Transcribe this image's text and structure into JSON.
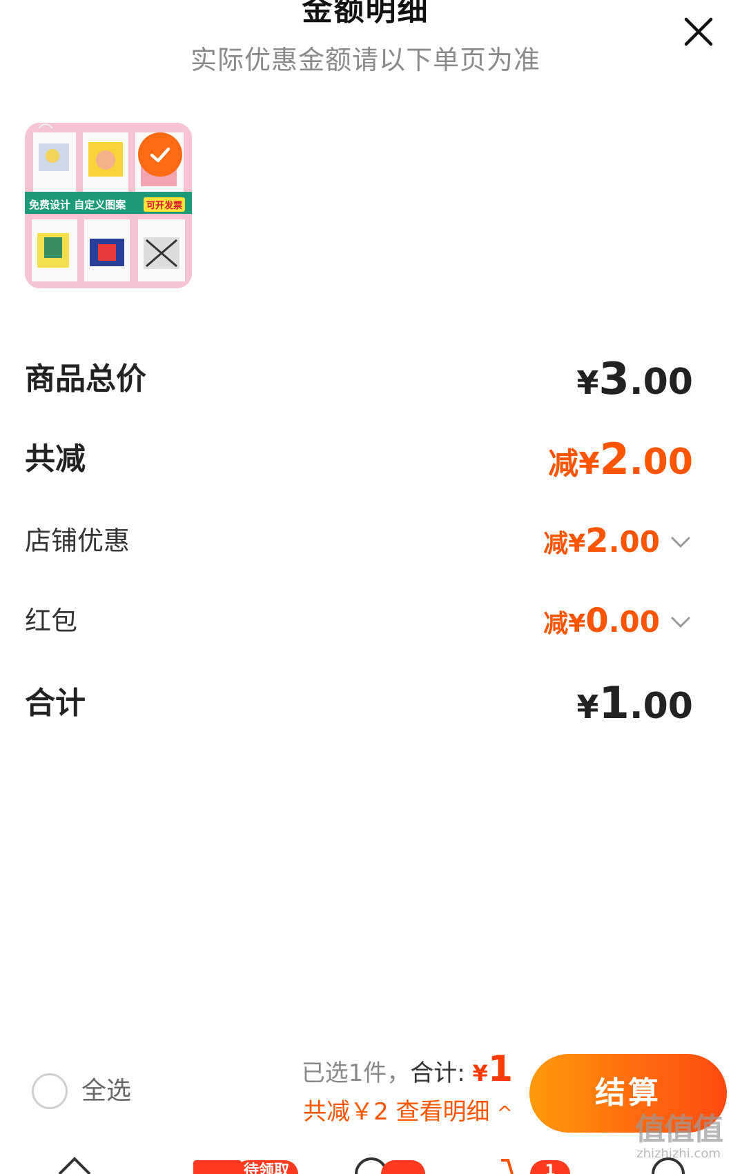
{
  "header": {
    "title": "金额明细",
    "subtitle": "实际优惠金额请以下单页为准",
    "close_icon": "close-icon"
  },
  "product": {
    "banner_text": "免费设计 自定义图案",
    "banner_badge": "可开发票",
    "selected": true
  },
  "breakdown": {
    "goods_total": {
      "label": "商品总价",
      "yen": "¥",
      "int": "3",
      "dec": ".00"
    },
    "total_discount": {
      "label": "共减",
      "prefix": "减¥",
      "int": "2",
      "dec": ".00"
    },
    "shop_discount": {
      "label": "店铺优惠",
      "prefix": "减¥",
      "int": "2",
      "dec": ".00"
    },
    "red_packet": {
      "label": "红包",
      "prefix": "减¥",
      "int": "0",
      "dec": ".00"
    },
    "total": {
      "label": "合计",
      "yen": "¥",
      "int": "1",
      "dec": ".00"
    }
  },
  "bottom_bar": {
    "select_all_label": "全选",
    "selected_count_text": "已选1件，",
    "total_label": "合计: ",
    "total_yen": "¥",
    "total_value": "1",
    "discount_detail_text": "共减￥2 查看明细",
    "caret": "^",
    "checkout_label": "结算"
  },
  "tabbar": {
    "coupon_pill": "待领取",
    "badge_message": "",
    "badge_cart": "1"
  },
  "watermark": {
    "big": "值值值",
    "small": "zhizhizhi.com"
  },
  "colors": {
    "accent": "#ff5500",
    "checkout_gradient_start": "#ff9a0a",
    "checkout_gradient_end": "#ff4a10",
    "muted_text": "#8a8a8a"
  }
}
